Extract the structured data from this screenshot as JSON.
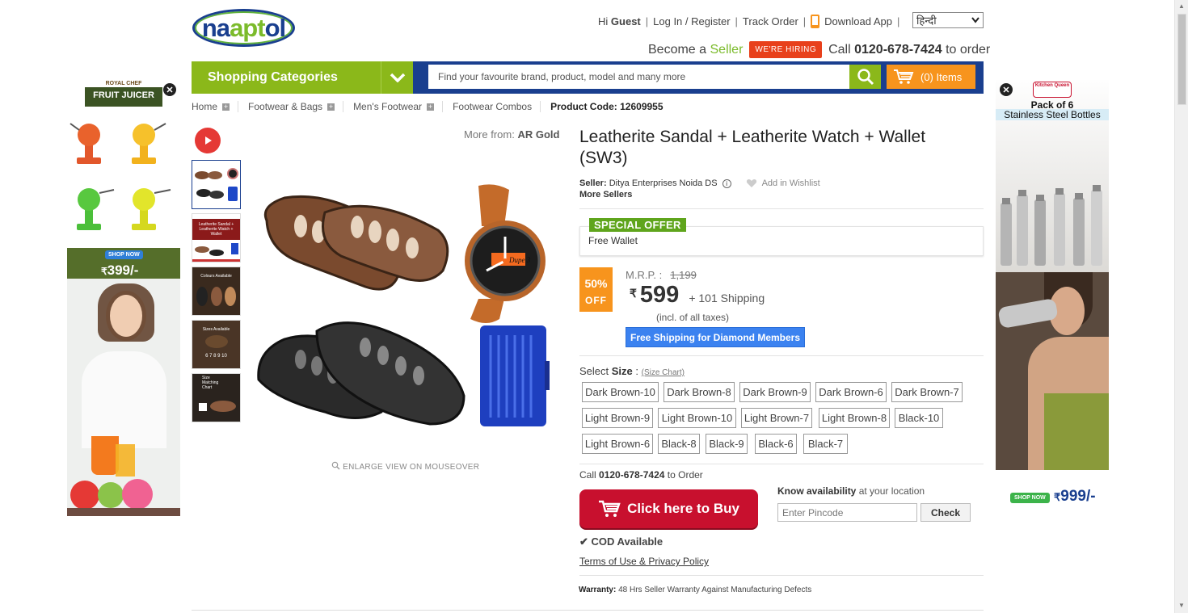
{
  "header": {
    "logo_text": "naaptol",
    "greeting_prefix": "Hi",
    "greeting_user": "Guest",
    "login": "Log In / Register",
    "track": "Track Order",
    "download": "Download App",
    "language": "हिन्दी",
    "become": "Become a",
    "seller": "Seller",
    "hiring": "WE'RE HIRING",
    "call_prefix": "Call",
    "phone": "0120-678-7424",
    "call_suffix": "to order"
  },
  "nav": {
    "categories": "Shopping Categories",
    "search_placeholder": "Find your favourite brand, product, model and many more",
    "cart_label": "(0) Items"
  },
  "breadcrumb": {
    "items": [
      "Home",
      "Footwear & Bags",
      "Men's Footwear",
      "Footwear Combos"
    ],
    "product_code_label": "Product Code:",
    "product_code": "12609955"
  },
  "gallery": {
    "more_from_label": "More from:",
    "more_from_brand": "AR Gold",
    "enlarge": "ENLARGE VIEW ON MOUSEOVER",
    "watch_text": "Dupe 3"
  },
  "product": {
    "title": "Leatherite Sandal + Leatherite Watch + Wallet (SW3)",
    "seller_label": "Seller:",
    "seller_name": "Ditya Enterprises Noida DS",
    "wishlist": "Add in Wishlist",
    "more_sellers": "More Sellers",
    "offer_tag": "SPECIAL OFFER",
    "offer_text": "Free Wallet",
    "discount_pct": "50%",
    "discount_off": "OFF",
    "mrp_label": "M.R.P. :",
    "mrp": "1,199",
    "currency": "₹",
    "price": "599",
    "shipping": "+ 101 Shipping",
    "incl_taxes": "(incl. of all taxes)",
    "free_shipping": "Free Shipping for Diamond Members",
    "select_label": "Select",
    "size_label": "Size",
    "size_chart": "(Size Chart)",
    "sizes": [
      "Dark Brown-10",
      "Dark Brown-8",
      "Dark Brown-9",
      "Dark Brown-6",
      "Dark Brown-7",
      "Light Brown-9",
      "Light Brown-10",
      "Light Brown-7",
      "Light Brown-8",
      "Black-10",
      "Light Brown-6",
      "Black-8",
      "Black-9",
      "Black-6",
      "Black-7"
    ],
    "call_prefix": "Call",
    "call_number": "0120-678-7424",
    "call_suffix": "to Order",
    "buy_button": "Click here to Buy",
    "avail_bold": "Know availability",
    "avail_rest": "at your location",
    "pincode_placeholder": "Enter Pincode",
    "check": "Check",
    "cod": "COD Available",
    "terms": "Terms of Use & Privacy Policy",
    "warranty_label": "Warranty:",
    "warranty_text": "48 Hrs Seller Warranty Against Manufacturing Defects"
  },
  "ads": {
    "left_brand": "ROYAL CHEF",
    "left_title": "FRUIT JUICER",
    "left_shop": "SHOP NOW",
    "left_price": "399/-",
    "right_brand": "Kitchen Queen",
    "right_title1": "Pack of 6",
    "right_title2": "Stainless Steel Bottles",
    "right_shop": "SHOP NOW",
    "right_price": "999/-",
    "currency": "₹"
  },
  "thumbs": {
    "t2_text": "Leatherite Sandal + Leatherite Watch + Wallet",
    "t3_text": "Colours Available",
    "t4_text": "Sizes Available",
    "t4_sizes": "6 7 8 9 10",
    "t5_text": "Size Matching Chart"
  }
}
